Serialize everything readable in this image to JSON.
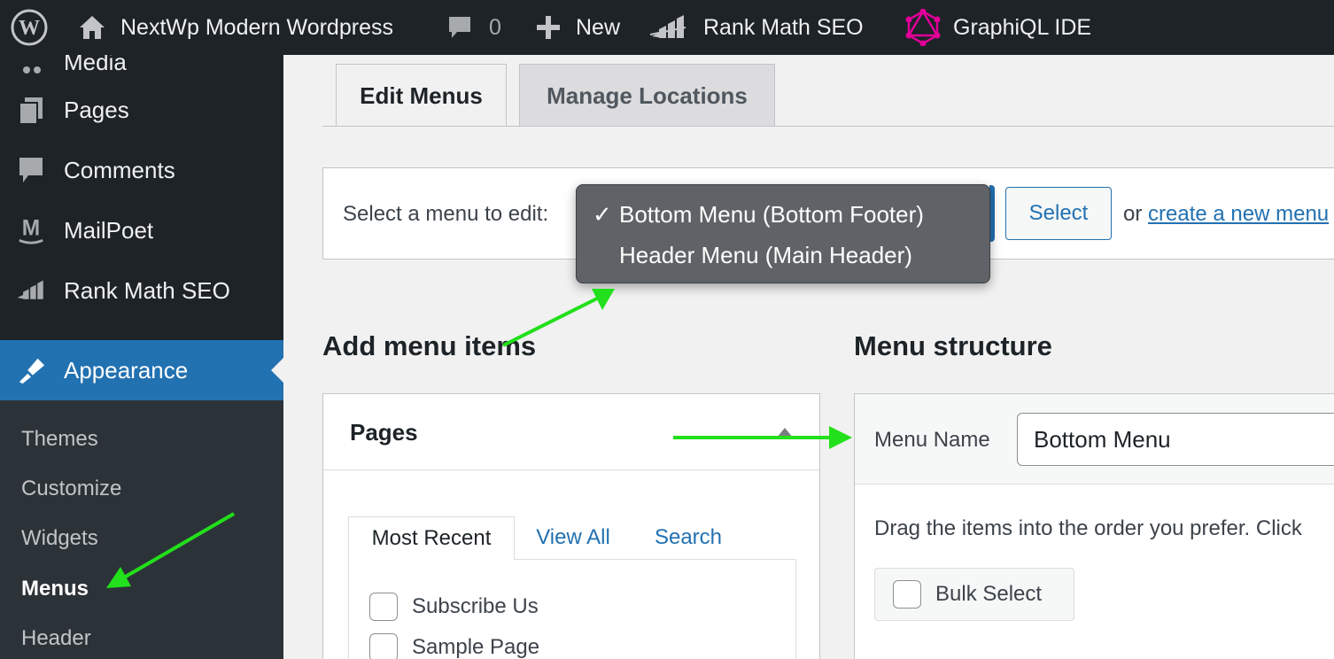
{
  "admin_bar": {
    "site_name": "NextWp Modern Wordpress",
    "comments_count": "0",
    "new_label": "New",
    "rank_math_label": "Rank Math SEO",
    "graphiql_label": "GraphiQL IDE"
  },
  "sidebar": {
    "cut_item": "Media",
    "items": [
      {
        "label": "Pages",
        "icon": "pages-icon"
      },
      {
        "label": "Comments",
        "icon": "comments-icon"
      },
      {
        "label": "MailPoet",
        "icon": "mailpoet-icon"
      },
      {
        "label": "Rank Math SEO",
        "icon": "rank-math-icon"
      },
      {
        "label": "Appearance",
        "icon": "appearance-icon"
      }
    ],
    "submenu": [
      "Themes",
      "Customize",
      "Widgets",
      "Menus",
      "Header"
    ],
    "current_submenu": "Menus"
  },
  "tabs": {
    "edit_menus": "Edit Menus",
    "manage_locations": "Manage Locations"
  },
  "menu_select": {
    "label": "Select a menu to edit:",
    "button": "Select",
    "or_text": "or",
    "create_link": "create a new menu",
    "options": [
      {
        "label": "Bottom Menu (Bottom Footer)",
        "selected": true
      },
      {
        "label": "Header Menu (Main Header)",
        "selected": false
      }
    ],
    "check_mark": "✓"
  },
  "add_items": {
    "heading": "Add menu items",
    "panel_title": "Pages",
    "tabs": [
      "Most Recent",
      "View All",
      "Search"
    ],
    "pages": [
      "Subscribe Us",
      "Sample Page"
    ]
  },
  "structure": {
    "heading": "Menu structure",
    "menu_name_label": "Menu Name",
    "menu_name_value": "Bottom Menu",
    "instructions": "Drag the items into the order you prefer. Click",
    "bulk_select": "Bulk Select"
  },
  "colors": {
    "admin_dark": "#1d2327",
    "accent_blue": "#2271b1",
    "annotation_green": "#22e01b",
    "graphiql_pink": "#e10098"
  }
}
